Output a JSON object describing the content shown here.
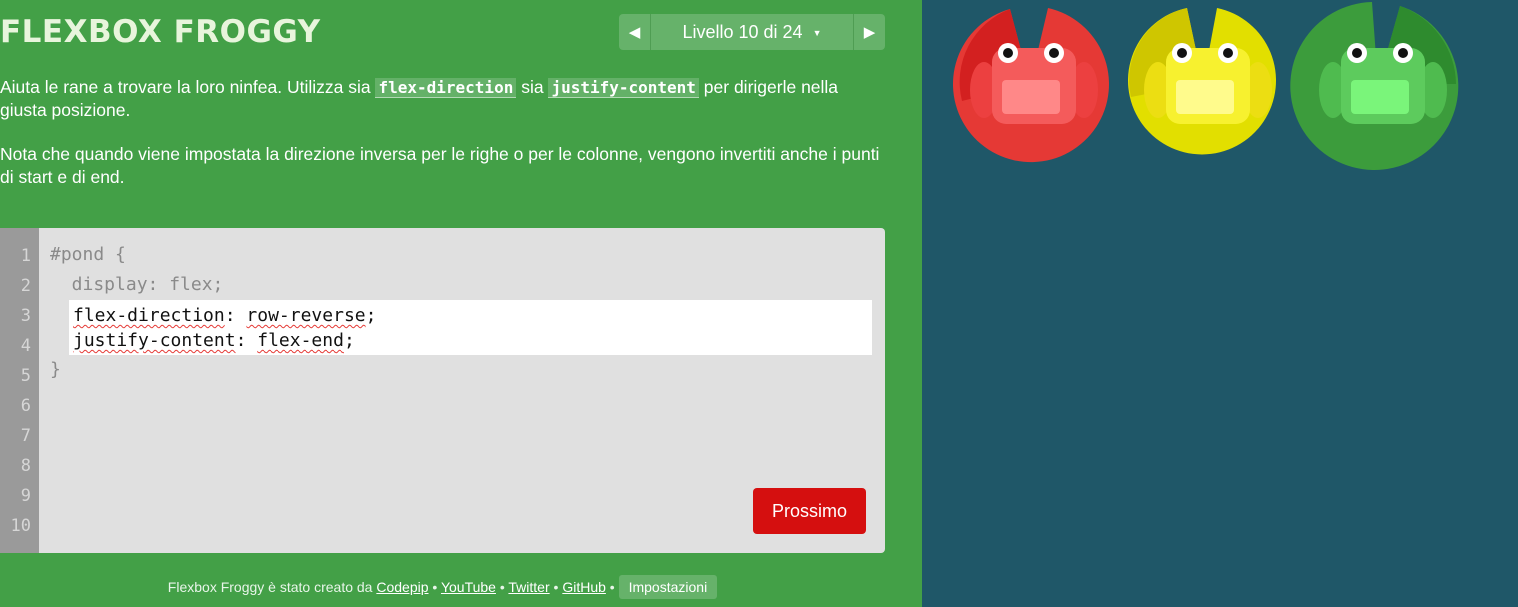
{
  "header": {
    "title": "FLEXBOX FROGGY",
    "level_label": "Livello 10 di 24",
    "prev_icon": "triangle-left",
    "next_icon": "triangle-right",
    "caret_icon": "caret-down"
  },
  "instructions": {
    "p1_text_1": "Aiuta le rane a trovare la loro ninfea. Utilizza sia ",
    "p1_code_1": "flex-direction",
    "p1_text_2": " sia ",
    "p1_code_2": "justify-content",
    "p1_text_3": " per dirigerle nella giusta posizione.",
    "p2": "Nota che quando viene impostata la direzione inversa per le righe o per le colonne, vengono invertiti anche i punti di start e di end."
  },
  "editor": {
    "line_numbers": [
      "1",
      "2",
      "3",
      "4",
      "5",
      "6",
      "7",
      "8",
      "9",
      "10"
    ],
    "line1": "#pond {",
    "line2": "  display: flex;",
    "input_line1_prop": "flex-direction",
    "input_line1_rest": ": ",
    "input_line1_val": "row-reverse",
    "input_line1_end": ";",
    "input_line2_prop": "justify-content",
    "input_line2_rest": ": ",
    "input_line2_val": "flex-end",
    "input_line2_end": ";",
    "line5": "}",
    "next_button": "Prossimo"
  },
  "footer": {
    "prefix": "Flexbox Froggy è stato creato da ",
    "link_codepip": "Codepip",
    "sep": " • ",
    "link_youtube": "YouTube",
    "link_twitter": "Twitter",
    "link_github": "GitHub",
    "settings": "Impostazioni"
  },
  "pond": {
    "background": "#1f5768",
    "lilypads": [
      {
        "color": "red",
        "pad_hex": "#e53935"
      },
      {
        "color": "yellow",
        "pad_hex": "#e2df00"
      },
      {
        "color": "green",
        "pad_hex": "#3c9c3c"
      }
    ],
    "frogs": [
      {
        "color": "red",
        "body_hex": "#f44b4b"
      },
      {
        "color": "yellow",
        "body_hex": "#f5ef2a"
      },
      {
        "color": "green",
        "body_hex": "#58c458"
      }
    ]
  }
}
